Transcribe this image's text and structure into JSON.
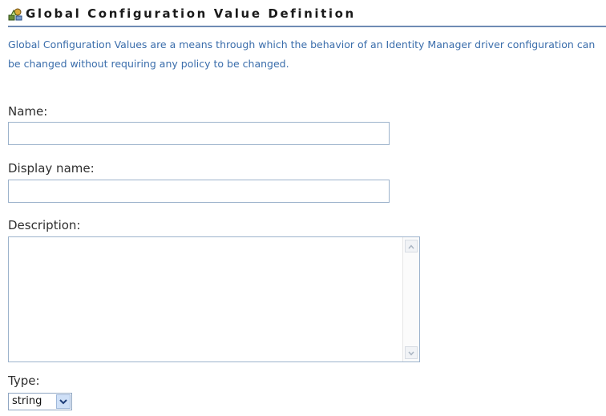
{
  "header": {
    "title": "Global Configuration Value Definition",
    "icon": "gcv-definition-icon"
  },
  "intro": {
    "text": "Global Configuration Values are a means through which the behavior of an Identity Manager driver configuration can be changed without requiring any policy to be changed."
  },
  "form": {
    "name_label": "Name:",
    "name_value": "",
    "display_name_label": "Display name:",
    "display_name_value": "",
    "description_label": "Description:",
    "description_value": "",
    "type_label": "Type:",
    "type_value": "string"
  },
  "colors": {
    "title_underline": "#6f8bb4",
    "intro_text": "#3a6dab",
    "input_border": "#9db3cc"
  }
}
